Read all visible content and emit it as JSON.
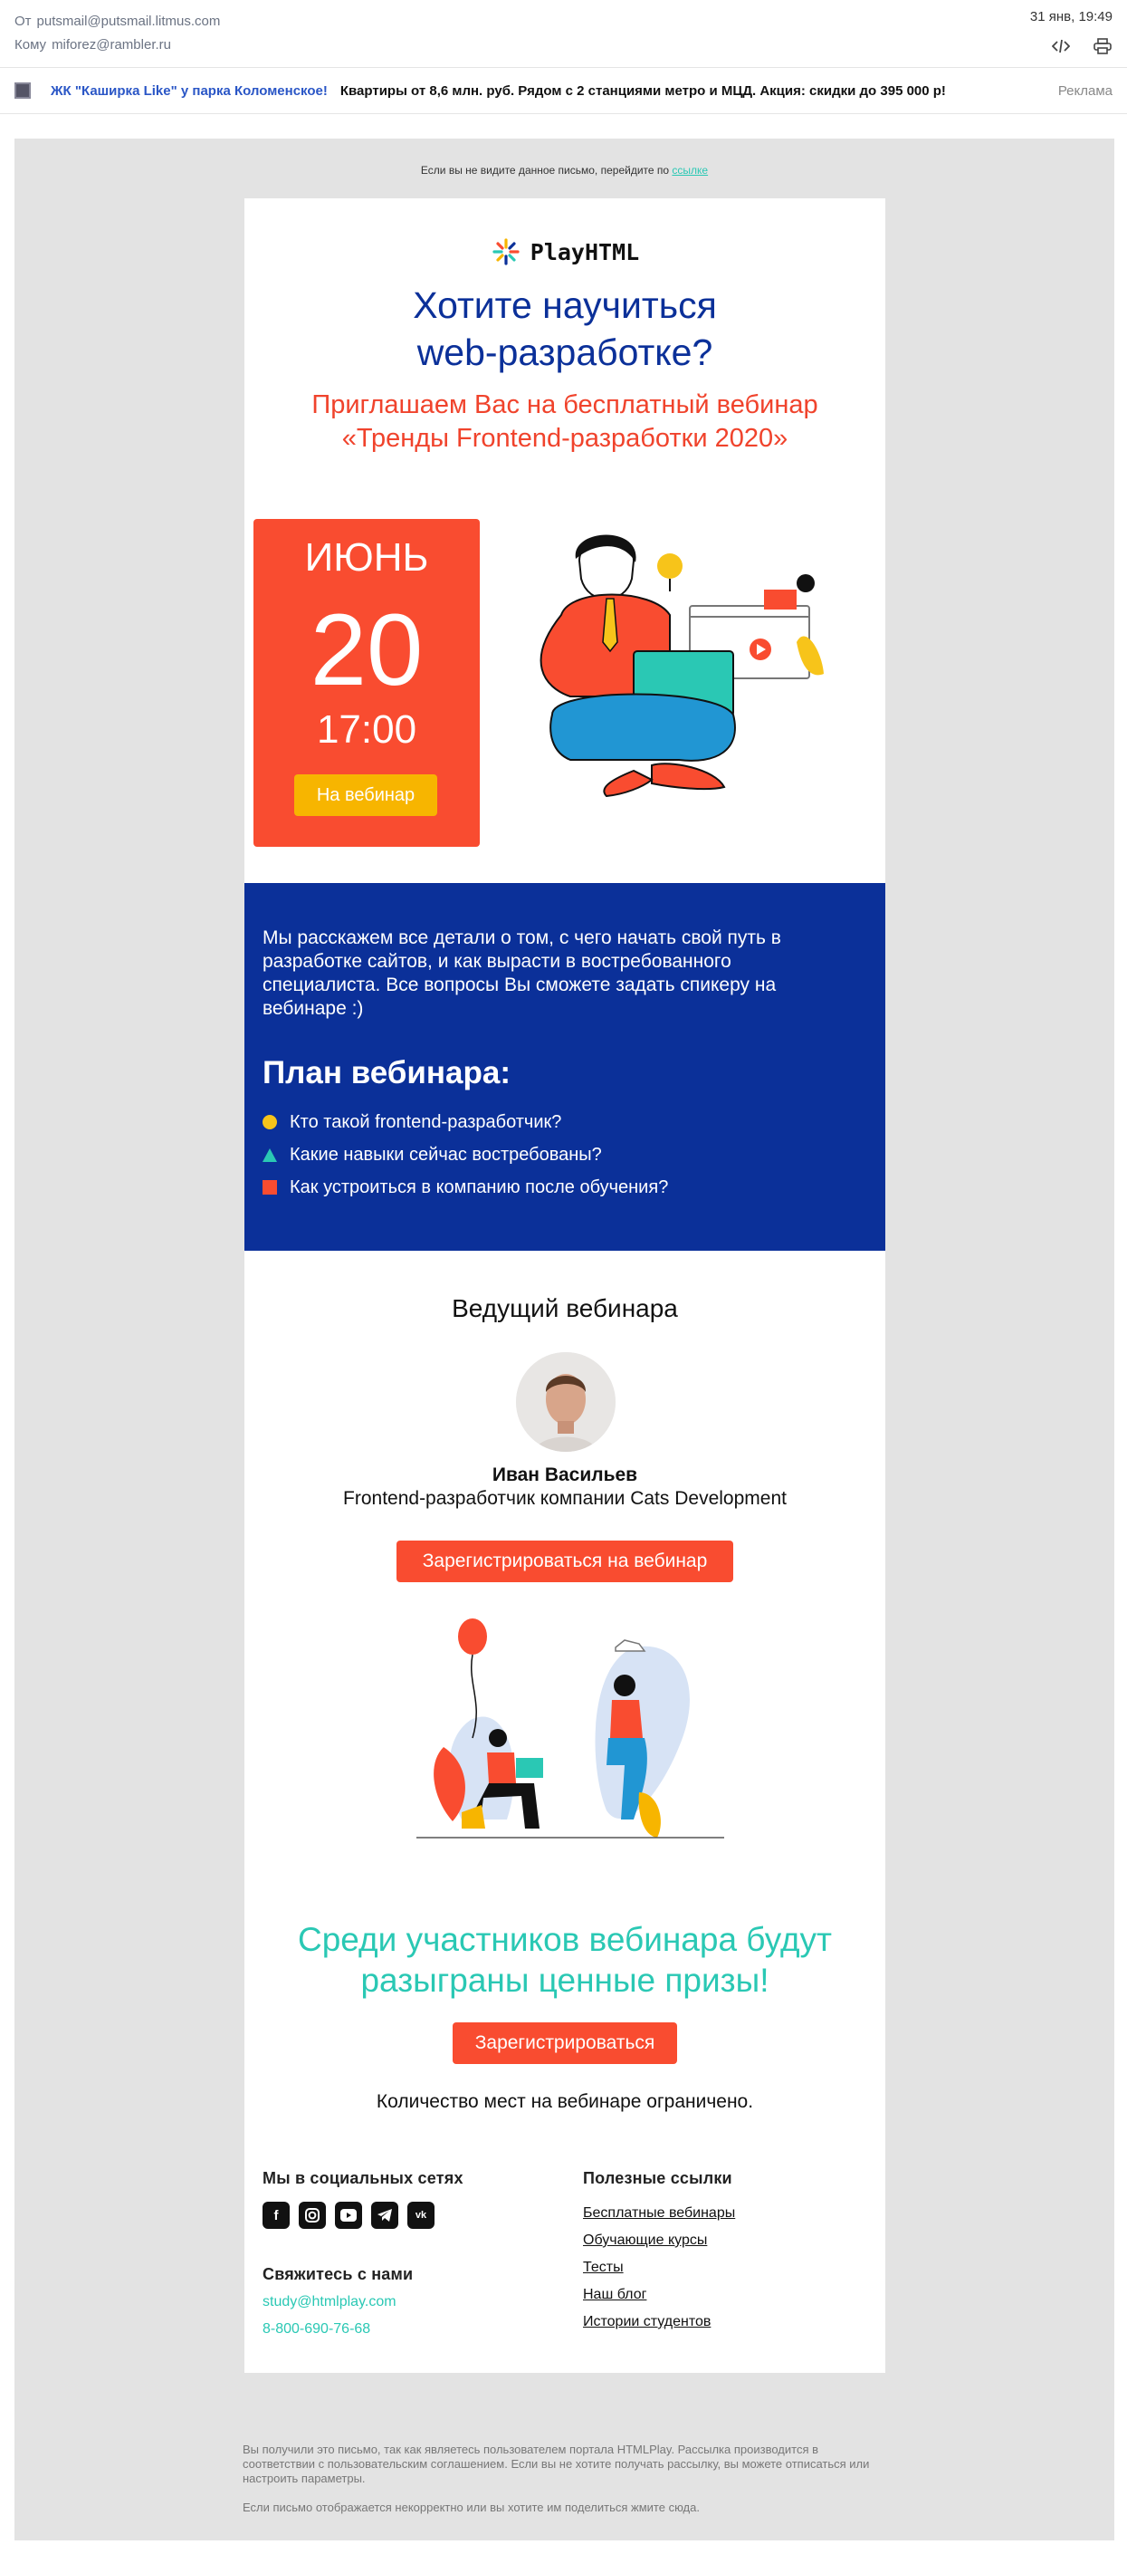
{
  "header": {
    "from_label": "От",
    "from": "putsmail@putsmail.litmus.com",
    "to_label": "Кому",
    "to": "miforez@rambler.ru",
    "date": "31 янв, 19:49",
    "icons": [
      "code-icon",
      "print-icon"
    ]
  },
  "ad": {
    "brand": "ЖК \"Каширка Like\" у парка Коломенское!",
    "text": "Квартиры от 8,6 млн. руб. Рядом с 2 станциями метро и МЦД. Акция: скидки до 395 000 р!",
    "tag": "Реклама"
  },
  "preheader": {
    "text": "Если вы не видите данное письмо, перейдите по ",
    "link": "ссылке"
  },
  "email": {
    "logo": "PlayHTML",
    "title_line1": "Хотите научиться",
    "title_line2": "web-разработке?",
    "subtitle": "Приглашаем Вас на бесплатный вебинар «Тренды Frontend-разработки 2020»",
    "month": "ИЮНЬ",
    "day": "20",
    "time": "17:00",
    "webinar_button": "На вебинар",
    "intro": "Мы расскажем все детали о том, с чего начать свой путь в разработке сайтов, и как вырасти в востребованного специалиста. Все вопросы Вы сможете задать спикеру на вебинаре :)",
    "plan_title": "План вебинара:",
    "plan": [
      "Кто такой frontend-разработчик?",
      "Какие навыки сейчас востребованы?",
      "Как устроиться в компанию после обучения?"
    ],
    "host_title": "Ведущий вебинара",
    "host_name": "Иван Васильев",
    "host_role": "Frontend-разработчик компании Cats Development",
    "register_webinar": "Зарегистрироваться на вебинар",
    "prize": "Среди участников вебинара будут разыграны ценные призы!",
    "register": "Зарегистрироваться",
    "limited": "Количество мест на вебинаре ограничено."
  },
  "footer": {
    "social_title": "Мы в социальных сетях",
    "social": [
      "facebook-icon",
      "instagram-icon",
      "youtube-icon",
      "telegram-icon",
      "vk-icon"
    ],
    "contact_title": "Свяжитесь с нами",
    "email": "study@htmlplay.com",
    "phone": "8-800-690-76-68",
    "links_title": "Полезные ссылки",
    "links": [
      "Бесплатные вебинары",
      "Обучающие курсы",
      "Тесты",
      "Наш блог",
      "Истории студентов"
    ],
    "legal1": "Вы получили это письмо, так как являетесь пользователем портала HTMLPlay. Рассылка производится в соответствии с пользовательским соглашением. Если вы не хотите получать рассылку, вы можете отписаться или настроить параметры.",
    "legal2": "Если письмо отображается некорректно или вы хотите им поделиться жмите сюда."
  },
  "colors": {
    "brand_blue": "#0b3099",
    "accent_red": "#f94c30",
    "accent_teal": "#2ac8b4",
    "accent_yellow": "#f7b500"
  }
}
